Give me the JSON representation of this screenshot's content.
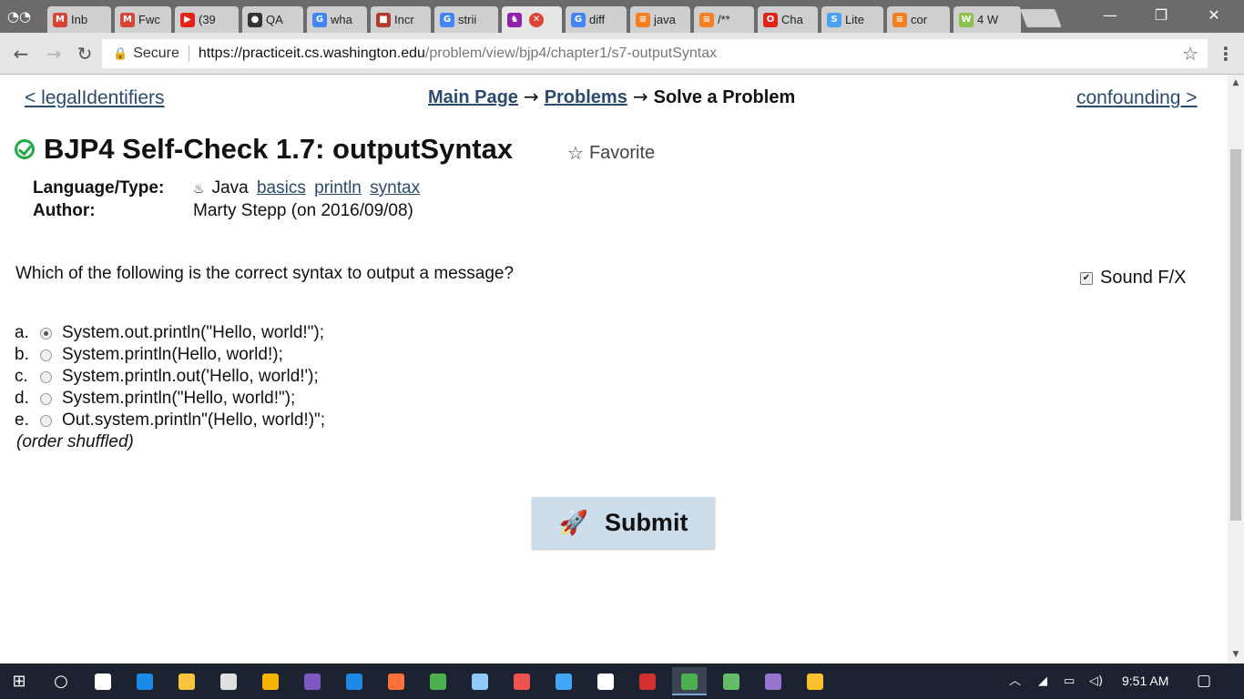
{
  "browser": {
    "tabs": [
      {
        "label": "Inb",
        "icon": "gmail-icon",
        "color": "#d44638",
        "glyph": "M"
      },
      {
        "label": "Fwc",
        "icon": "gmail-icon",
        "color": "#d44638",
        "glyph": "M"
      },
      {
        "label": "(39",
        "icon": "youtube-icon",
        "color": "#e62117",
        "glyph": "▶"
      },
      {
        "label": "QA",
        "icon": "github-icon",
        "color": "#333333",
        "glyph": "●"
      },
      {
        "label": "wha",
        "icon": "google-icon",
        "color": "#4285f4",
        "glyph": "G"
      },
      {
        "label": "Incr",
        "icon": "box-icon",
        "color": "#b03a2e",
        "glyph": "■"
      },
      {
        "label": "strii",
        "icon": "google-icon",
        "color": "#4285f4",
        "glyph": "G"
      },
      {
        "label": "",
        "icon": "purple-figure-icon",
        "color": "#8e24aa",
        "glyph": "♞"
      },
      {
        "label": "diff",
        "icon": "google-icon",
        "color": "#4285f4",
        "glyph": "G"
      },
      {
        "label": "java",
        "icon": "stackoverflow-icon",
        "color": "#f48024",
        "glyph": "≡"
      },
      {
        "label": "/**",
        "icon": "stackoverflow-icon",
        "color": "#f48024",
        "glyph": "≡"
      },
      {
        "label": "Cha",
        "icon": "oracle-icon",
        "color": "#e2231a",
        "glyph": "O"
      },
      {
        "label": "Lite",
        "icon": "steemit-icon",
        "color": "#4ba2f2",
        "glyph": "S"
      },
      {
        "label": "cor",
        "icon": "stackoverflow-icon",
        "color": "#f48024",
        "glyph": "≡"
      },
      {
        "label": "4 W",
        "icon": "wh-icon",
        "color": "#8bc34a",
        "glyph": "W"
      }
    ],
    "secure_label": "Secure",
    "url_host": "https://practiceit.cs.washington.edu",
    "url_path": "/problem/view/bjp4/chapter1/s7-outputSyntax"
  },
  "nav": {
    "prev_link": "< legalIdentifiers",
    "next_link": "confounding >",
    "crumb_main": "Main Page",
    "crumb_arrow": "→",
    "crumb_problems": "Problems",
    "crumb_current": "Solve a Problem"
  },
  "problem": {
    "title": "BJP4 Self-Check 1.7: outputSyntax",
    "favorite_label": "Favorite",
    "language_key": "Language/Type:",
    "language_value": "Java",
    "tags": [
      "basics",
      "println",
      "syntax"
    ],
    "author_key": "Author:",
    "author_value": "Marty Stepp (on 2016/09/08)",
    "question": "Which of the following is the correct syntax to output a message?",
    "sound_label": "Sound F/X",
    "sound_checked": true,
    "choices": [
      {
        "letter": "a.",
        "text": "System.out.println(\"Hello, world!\");",
        "selected": true
      },
      {
        "letter": "b.",
        "text": "System.println(Hello, world!);",
        "selected": false
      },
      {
        "letter": "c.",
        "text": "System.println.out('Hello, world!');",
        "selected": false
      },
      {
        "letter": "d.",
        "text": "System.println(\"Hello, world!\");",
        "selected": false
      },
      {
        "letter": "e.",
        "text": "Out.system.println\"(Hello, world!)\";",
        "selected": false
      }
    ],
    "shuffled_note": "(order shuffled)",
    "submit_label": "Submit"
  },
  "taskbar": {
    "clock": "9:51 AM",
    "apps": [
      {
        "name": "task-view-icon",
        "color": "#ffffff"
      },
      {
        "name": "edge-icon",
        "color": "#1e88e5"
      },
      {
        "name": "file-explorer-icon",
        "color": "#f9c440"
      },
      {
        "name": "store-icon",
        "color": "#e0e0e0"
      },
      {
        "name": "grid-app-icon",
        "color": "#f4b400"
      },
      {
        "name": "eclipse-icon",
        "color": "#7e57c2"
      },
      {
        "name": "ie-icon",
        "color": "#1e88e5"
      },
      {
        "name": "firefox-icon",
        "color": "#ff7139"
      },
      {
        "name": "chrome-icon",
        "color": "#4caf50"
      },
      {
        "name": "photos-icon",
        "color": "#90caf9"
      },
      {
        "name": "paint-icon",
        "color": "#ef5350"
      },
      {
        "name": "network-app-icon",
        "color": "#42a5f5"
      },
      {
        "name": "mail-icon",
        "color": "#ffffff"
      },
      {
        "name": "acrobat-icon",
        "color": "#d32f2f"
      },
      {
        "name": "chrome-active-icon",
        "color": "#4caf50"
      },
      {
        "name": "git-icon",
        "color": "#66bb6a"
      },
      {
        "name": "eclipse2-icon",
        "color": "#9575cd"
      },
      {
        "name": "paint3d-icon",
        "color": "#fbc02d"
      }
    ]
  }
}
